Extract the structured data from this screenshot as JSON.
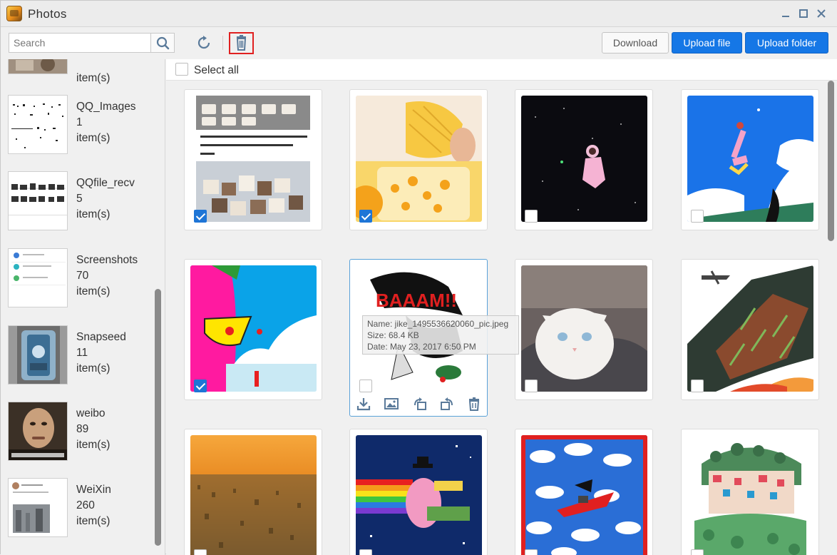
{
  "window": {
    "title": "Photos"
  },
  "toolbar": {
    "search_placeholder": "Search",
    "download_label": "Download",
    "upload_file_label": "Upload file",
    "upload_folder_label": "Upload folder"
  },
  "sidebar": {
    "albums": [
      {
        "name": "",
        "count": "",
        "unit": "item(s)"
      },
      {
        "name": "QQ_Images",
        "count": "1",
        "unit": "item(s)"
      },
      {
        "name": "QQfile_recv",
        "count": "5",
        "unit": "item(s)"
      },
      {
        "name": "Screenshots",
        "count": "70",
        "unit": "item(s)"
      },
      {
        "name": "Snapseed",
        "count": "11",
        "unit": "item(s)"
      },
      {
        "name": "weibo",
        "count": "89",
        "unit": "item(s)"
      },
      {
        "name": "WeiXin",
        "count": "260",
        "unit": "item(s)"
      }
    ]
  },
  "main": {
    "select_all_label": "Select all",
    "tooltip": {
      "name": "Name: jike_1495536620060_pic.jpeg",
      "size": "Size: 68.4 KB",
      "date": "Date: May 23, 2017 6:50 PM"
    },
    "photos": [
      {
        "id": "food-text",
        "checked": true
      },
      {
        "id": "mango",
        "checked": true
      },
      {
        "id": "space-astronaut",
        "checked": false
      },
      {
        "id": "pink-figure-sky",
        "checked": false
      },
      {
        "id": "cartoon-face",
        "checked": true
      },
      {
        "id": "baaam-comic",
        "checked": false,
        "active": true
      },
      {
        "id": "white-cat",
        "checked": false
      },
      {
        "id": "hill-plane",
        "checked": false
      },
      {
        "id": "sunset-city",
        "checked": false
      },
      {
        "id": "rainbow-man",
        "checked": false
      },
      {
        "id": "witch-clouds",
        "checked": false
      },
      {
        "id": "forest-town",
        "checked": false
      }
    ]
  },
  "colors": {
    "accent": "#1577e6",
    "highlight": "#e02020",
    "checkbox_checked": "#1e75d6"
  }
}
